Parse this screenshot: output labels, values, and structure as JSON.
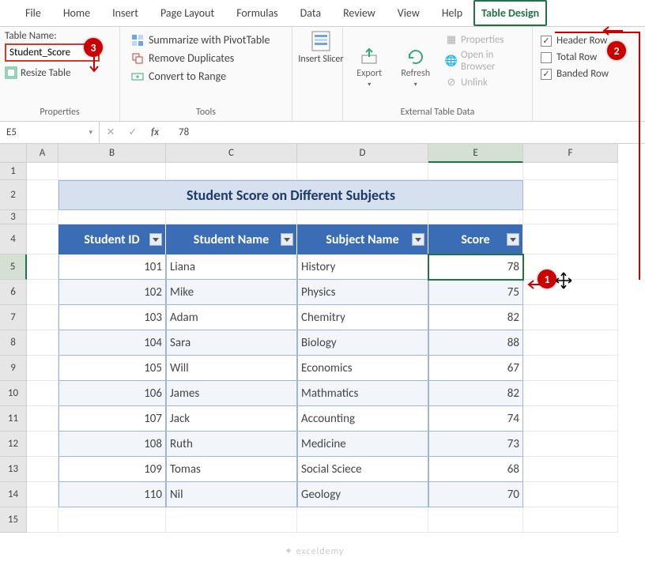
{
  "tabs": {
    "file": "File",
    "home": "Home",
    "insert": "Insert",
    "page": "Page Layout",
    "formulas": "Formulas",
    "data": "Data",
    "review": "Review",
    "view": "View",
    "help": "Help",
    "design": "Table Design"
  },
  "ribbon": {
    "properties": {
      "table_name_label": "Table Name:",
      "table_name": "Student_Score",
      "resize": "Resize Table",
      "group": "Properties"
    },
    "tools": {
      "pivot": "Summarize with PivotTable",
      "dup": "Remove Duplicates",
      "range": "Convert to Range",
      "group": "Tools"
    },
    "slicer": {
      "label": "Insert Slicer"
    },
    "ext": {
      "export": "Export",
      "refresh": "Refresh",
      "props": "Properties",
      "browser": "Open in Browser",
      "unlink": "Unlink",
      "group": "External Table Data"
    },
    "opts": {
      "header": "Header Row",
      "total": "Total Row",
      "banded": "Banded Row"
    }
  },
  "fbar": {
    "name": "E5",
    "formula": "78"
  },
  "cols": {
    "a": "A",
    "b": "B",
    "c": "C",
    "d": "D",
    "e": "E",
    "f": "F"
  },
  "title": "Student Score on Different Subjects",
  "headers": {
    "id": "Student ID",
    "name": "Student Name",
    "subj": "Subject Name",
    "score": "Score"
  },
  "rows": [
    {
      "n": "5",
      "id": "101",
      "name": "Liana",
      "subj": "History",
      "score": "78"
    },
    {
      "n": "6",
      "id": "102",
      "name": "Mike",
      "subj": "Physics",
      "score": "75"
    },
    {
      "n": "7",
      "id": "103",
      "name": "Adam",
      "subj": "Chemitry",
      "score": "82"
    },
    {
      "n": "8",
      "id": "104",
      "name": "Sara",
      "subj": "Biology",
      "score": "88"
    },
    {
      "n": "9",
      "id": "105",
      "name": "Will",
      "subj": "Economics",
      "score": "67"
    },
    {
      "n": "10",
      "id": "106",
      "name": "James",
      "subj": "Mathmatics",
      "score": "82"
    },
    {
      "n": "11",
      "id": "107",
      "name": "Jack",
      "subj": "Accounting",
      "score": "74"
    },
    {
      "n": "12",
      "id": "108",
      "name": "Ruth",
      "subj": "Medicine",
      "score": "73"
    },
    {
      "n": "13",
      "id": "109",
      "name": "Tomas",
      "subj": "Social Sciece",
      "score": "68"
    },
    {
      "n": "14",
      "id": "110",
      "name": "Nil",
      "subj": "Geology",
      "score": "70"
    }
  ],
  "watermark": "exceldemy"
}
